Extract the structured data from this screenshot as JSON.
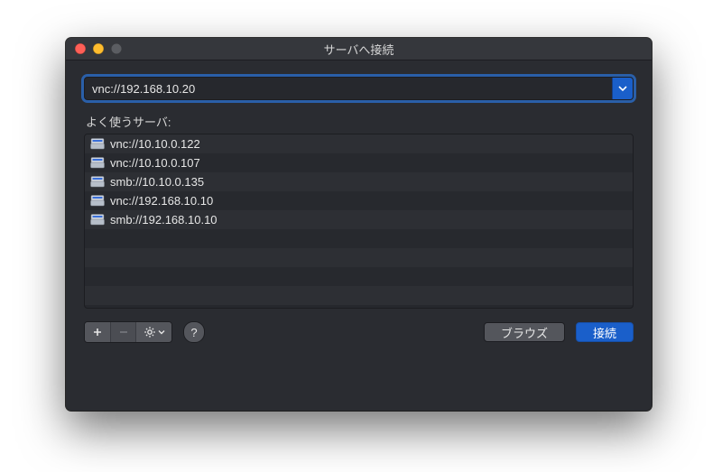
{
  "window": {
    "title": "サーバへ接続"
  },
  "address": {
    "value": "vnc://192.168.10.20"
  },
  "favorites": {
    "label": "よく使うサーバ:",
    "items": [
      {
        "url": "vnc://10.10.0.122"
      },
      {
        "url": "vnc://10.10.0.107"
      },
      {
        "url": "smb://10.10.0.135"
      },
      {
        "url": "vnc://192.168.10.10"
      },
      {
        "url": "smb://192.168.10.10"
      }
    ]
  },
  "buttons": {
    "browse": "ブラウズ",
    "connect": "接続",
    "help": "?"
  }
}
